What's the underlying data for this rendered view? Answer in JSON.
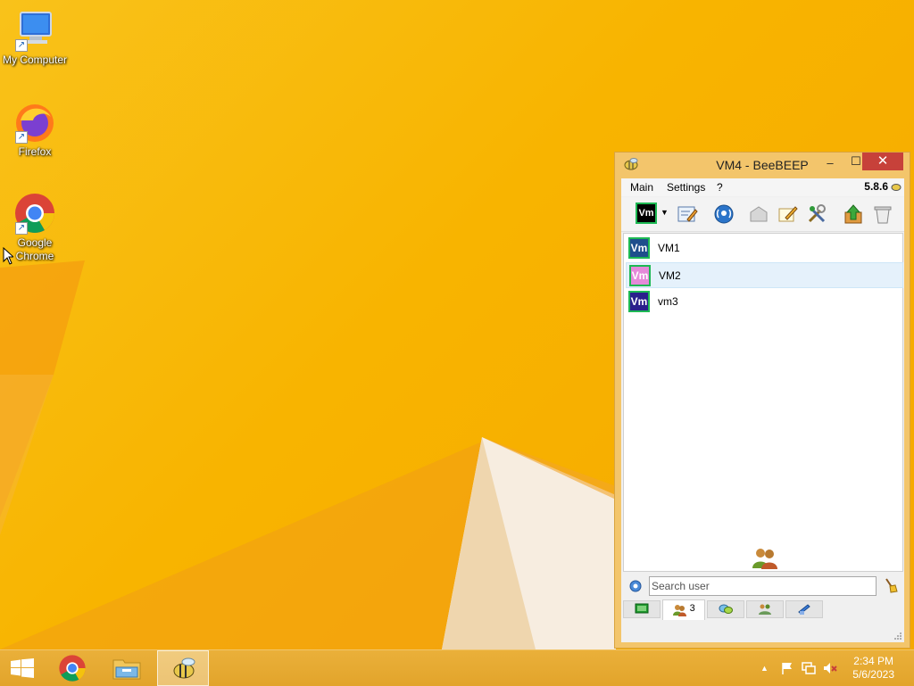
{
  "desktop": {
    "icons": [
      {
        "label": "My Computer"
      },
      {
        "label": "Firefox"
      },
      {
        "label": "Google Chrome"
      }
    ]
  },
  "window": {
    "title": "VM4 - BeeBEEP",
    "minimize_glyph": "–",
    "maximize_glyph": "☐",
    "close_glyph": "✕",
    "menu": {
      "main": "Main",
      "settings": "Settings",
      "help": "?"
    },
    "version": "5.8.6",
    "status_avatar": "Vm",
    "users": [
      {
        "avatar": "Vm",
        "name": "VM1",
        "color": "#1f4e8c"
      },
      {
        "avatar": "Vm",
        "name": "VM2",
        "color": "#e58ad9"
      },
      {
        "avatar": "Vm",
        "name": "vm3",
        "color": "#2a1f8c"
      }
    ],
    "search": {
      "placeholder": "Search user"
    },
    "tabs": {
      "users_count": "3"
    }
  },
  "taskbar": {
    "time": "2:34 PM",
    "date": "5/6/2023",
    "tray_arrow": "▲"
  },
  "colors": {
    "accent": "#f3c56b",
    "close": "#c7413a",
    "online": "#1db954"
  }
}
